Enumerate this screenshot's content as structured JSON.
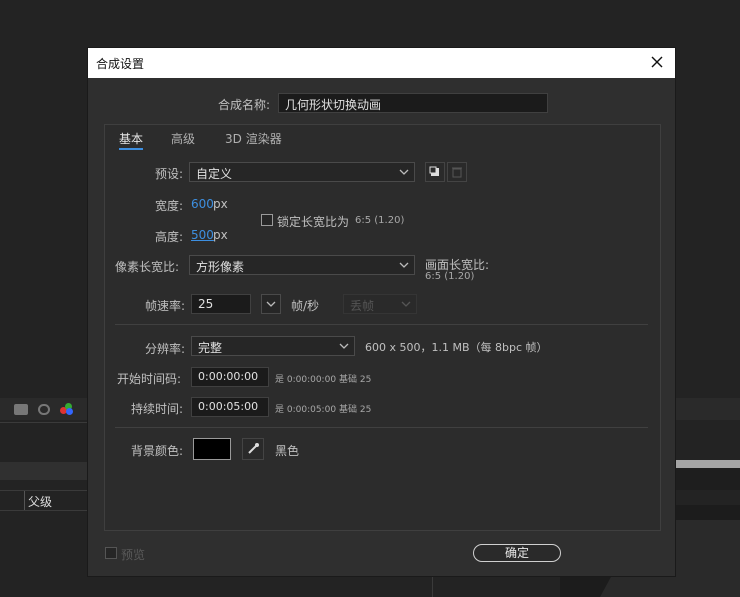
{
  "dialog": {
    "title": "合成设置",
    "comp_name_label": "合成名称:",
    "comp_name_value": "几何形状切换动画",
    "tabs": [
      {
        "label": "基本",
        "active": true
      },
      {
        "label": "高级",
        "active": false
      },
      {
        "label": "3D 渲染器",
        "active": false
      }
    ],
    "preset": {
      "label": "预设:",
      "value": "自定义"
    },
    "width": {
      "label": "宽度:",
      "value": "600",
      "unit": "px"
    },
    "height": {
      "label": "高度:",
      "value": "500",
      "unit": "px"
    },
    "lock_aspect": {
      "label": "锁定长宽比为",
      "value": "6:5 (1.20)",
      "checked": false
    },
    "pixel_aspect": {
      "label": "像素长宽比:",
      "value": "方形像素"
    },
    "frame_aspect": {
      "label": "画面长宽比:",
      "value": "6:5 (1.20)"
    },
    "frame_rate": {
      "label": "帧速率:",
      "value": "25",
      "unit": "帧/秒",
      "drop_frame": "丢帧"
    },
    "resolution": {
      "label": "分辨率:",
      "value": "完整",
      "info": "600 x 500，1.1 MB（每 8bpc 帧）"
    },
    "start_timecode": {
      "label": "开始时间码:",
      "value": "0:00:00:00",
      "note_is": "是 0:00:00:00",
      "note_base": "基础 25"
    },
    "duration": {
      "label": "持续时间:",
      "value": "0:00:05:00",
      "note_is": "是 0:00:05:00",
      "note_base": "基础 25"
    },
    "bg_color": {
      "label": "背景颜色:",
      "name": "黑色",
      "hex": "#000000"
    },
    "preview_label": "预览",
    "ok_label": "确定"
  },
  "background": {
    "parent_label": "父级"
  }
}
